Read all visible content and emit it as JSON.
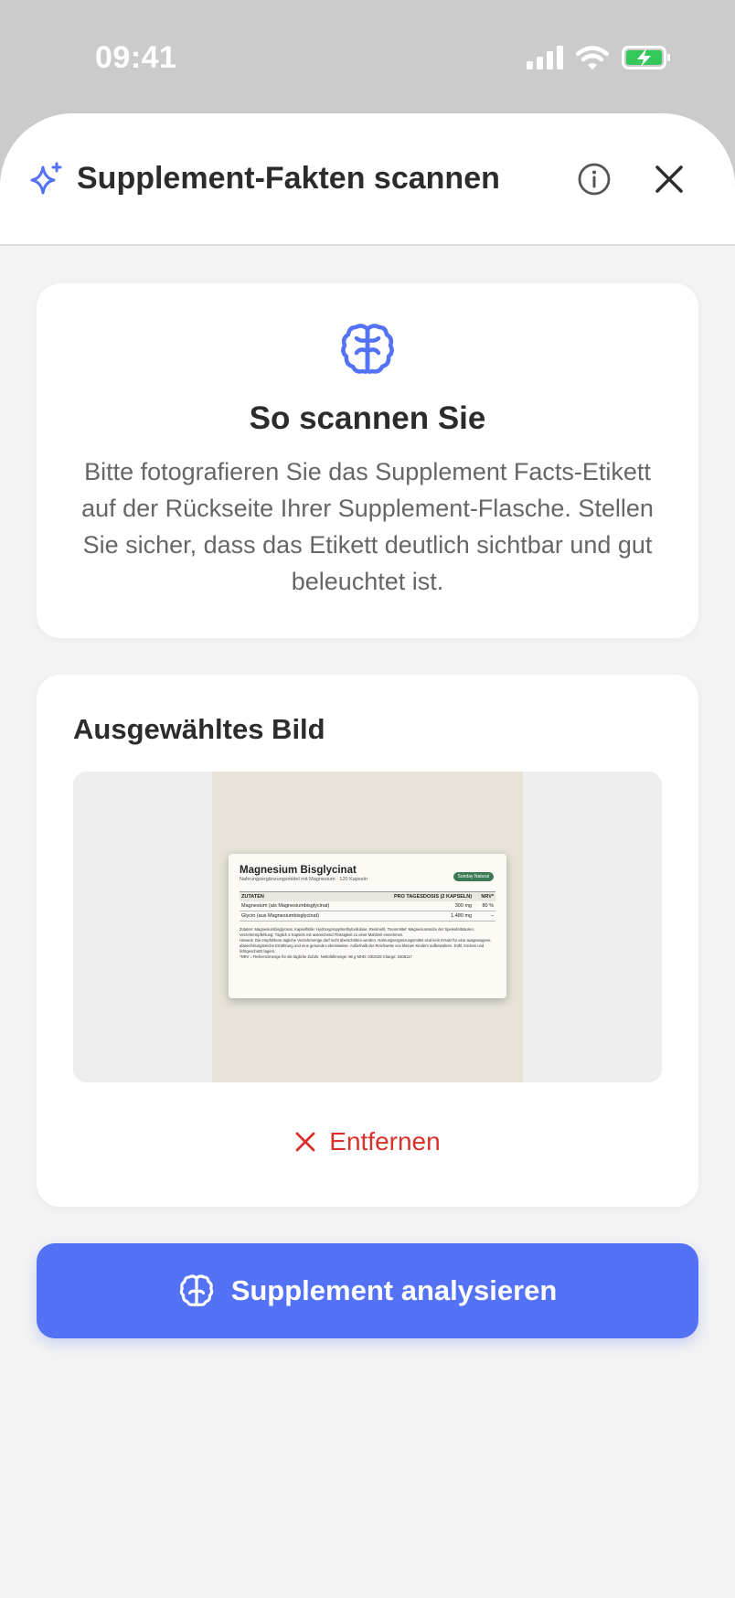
{
  "status_bar": {
    "time": "09:41",
    "icons": [
      "cellular-signal-icon",
      "wifi-icon",
      "battery-charging-icon"
    ]
  },
  "header": {
    "title": "Supplement-Fakten scannen",
    "icons": [
      "sparkle-icon",
      "info-icon",
      "close-icon"
    ]
  },
  "howto": {
    "icon": "brain-icon",
    "title": "So scannen Sie",
    "text": "Bitte fotografieren Sie das Supplement Facts-Etikett auf der Rückseite Ihrer Supplement-Flasche. Stellen Sie sicher, dass das Etikett deutlich sichtbar und gut beleuchtet ist."
  },
  "selected_image": {
    "title": "Ausgewähltes Bild",
    "remove_label": "Entfernen",
    "photo_label": {
      "product_name": "Magnesium Bisglycinat",
      "subtitle": "Nahrungsergänzungsmittel mit Magnesium · 120 Kapseln",
      "brand": "Sunday Natural",
      "columns": [
        "ZUTATEN",
        "PRO TAGESDOSIS (2 KAPSELN)",
        "NRV*"
      ],
      "rows": [
        [
          "Magnesium (als Magnesiumbisglycinat)",
          "300 mg",
          "80 %"
        ],
        [
          "Glycin (aus Magnesiumbisglycinat)",
          "1.480 mg",
          "–"
        ]
      ],
      "notes": [
        "Zutaten: Magnesiumbisglycinat, Kapselhülle: Hydroxypropylmethylcellulose, Reismehl, Trennmittel: Magnesiumsalze der Speisefettsäuren.",
        "Verzehrempfehlung: Täglich 2 Kapseln mit ausreichend Flüssigkeit zu einer Mahlzeit einnehmen.",
        "Hinweis: Die empfohlene tägliche Verzehrmenge darf nicht überschritten werden. Nahrungsergänzungsmittel sind kein Ersatz für eine ausgewogene, abwechslungsreiche Ernährung und eine gesunde Lebensweise. Außerhalb der Reichweite von kleinen Kindern aufbewahren. Kühl, trocken und lichtgeschützt lagern.",
        "*NRV = Referenzmenge für die tägliche Zufuhr. Nettofüllmenge: 96 g MHD: 03/2028 Charge: 2408117"
      ]
    }
  },
  "analyze_button": {
    "label": "Supplement analysieren",
    "icon": "brain-icon"
  },
  "colors": {
    "accent": "#5472f6",
    "danger": "#d9302b",
    "background": "#f3f3f3",
    "card": "#ffffff"
  }
}
